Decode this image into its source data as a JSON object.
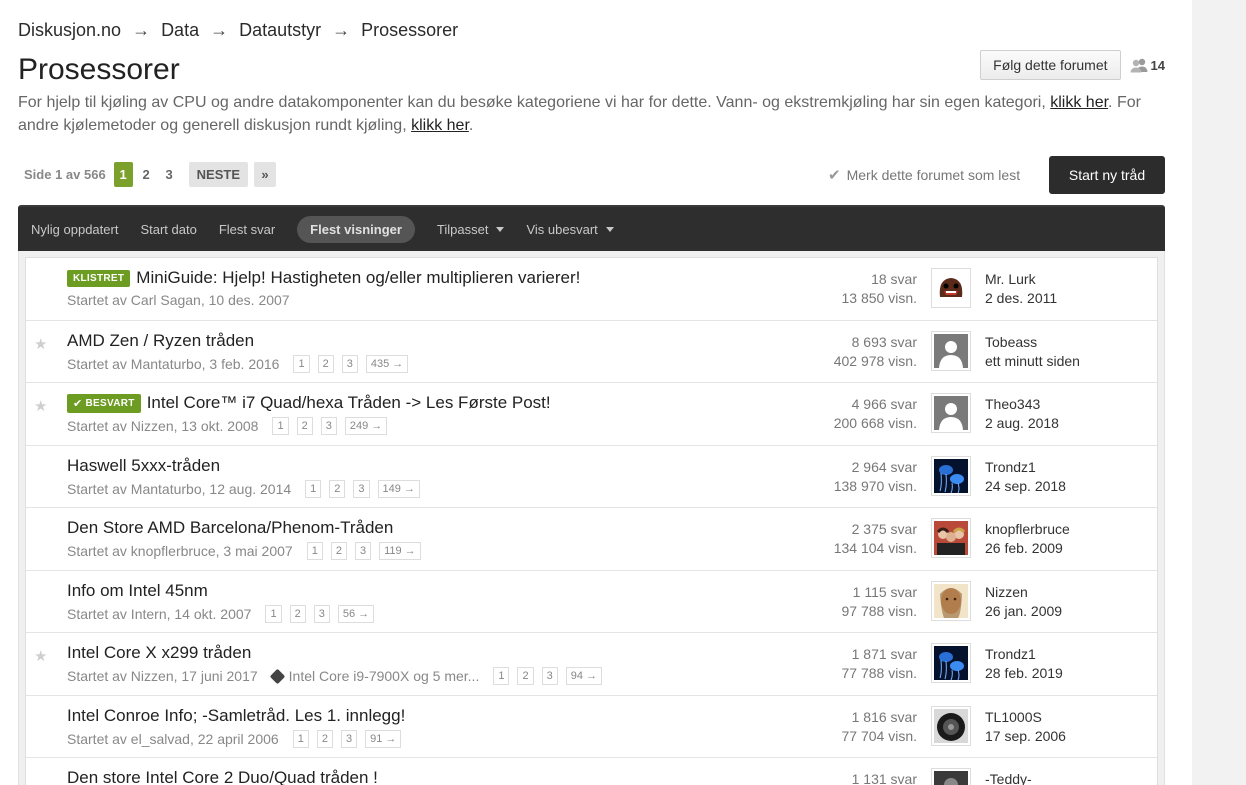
{
  "breadcrumb": [
    "Diskusjon.no",
    "Data",
    "Datautstyr",
    "Prosessorer"
  ],
  "breadcrumb_separator": "→",
  "page_title": "Prosessorer",
  "follow_button": "Følg dette forumet",
  "follower_count": "14",
  "description": {
    "part1": "For hjelp til kjøling av CPU og andre datakomponenter kan du besøke kategoriene vi har for dette. Vann- og ekstremkjøling har sin egen kategori, ",
    "link1": "klikk her",
    "part2": ". For andre kjølemetoder og generell diskusjon rundt kjøling, ",
    "link2": "klikk her",
    "part3": "."
  },
  "pagination": {
    "info": "Side 1 av 566",
    "pages": [
      "1",
      "2",
      "3"
    ],
    "current": "1",
    "next": "NESTE",
    "last": "»"
  },
  "mark_read": "Merk dette forumet som lest",
  "start_thread": "Start ny tråd",
  "sort_tabs": [
    {
      "label": "Nylig oppdatert",
      "active": false,
      "dropdown": false
    },
    {
      "label": "Start dato",
      "active": false,
      "dropdown": false
    },
    {
      "label": "Flest svar",
      "active": false,
      "dropdown": false
    },
    {
      "label": "Flest visninger",
      "active": true,
      "dropdown": false
    },
    {
      "label": "Tilpasset",
      "active": false,
      "dropdown": true
    },
    {
      "label": "Vis ubesvart",
      "active": false,
      "dropdown": true
    }
  ],
  "colors": {
    "accent_green": "#6d9c23",
    "sort_bar": "#2e2e2e",
    "start_button": "#2c2c2c"
  },
  "threads": [
    {
      "star": false,
      "tag": "KLISTRET",
      "title": "MiniGuide: Hjelp! Hastigheten og/eller multiplieren varierer!",
      "meta": "Startet av Carl Sagan, 10 des. 2007",
      "tags_text": "",
      "pages": [],
      "replies": "18 svar",
      "views": "13 850 visn.",
      "last_user": "Mr. Lurk",
      "last_date": "2 des. 2011",
      "avatar": "domo-icon"
    },
    {
      "star": true,
      "tag": "",
      "title": "AMD Zen / Ryzen tråden",
      "meta": "Startet av Mantaturbo, 3 feb. 2016",
      "tags_text": "",
      "pages": [
        "1",
        "2",
        "3",
        "435 →"
      ],
      "replies": "8 693 svar",
      "views": "402 978 visn.",
      "last_user": "Tobeass",
      "last_date": "ett minutt siden",
      "avatar": "default-user-icon"
    },
    {
      "star": true,
      "tag": "BESVART",
      "title": "Intel Core™ i7 Quad/hexa Tråden -> Les Første Post!",
      "meta": "Startet av Nizzen, 13 okt. 2008",
      "tags_text": "",
      "pages": [
        "1",
        "2",
        "3",
        "249 →"
      ],
      "replies": "4 966 svar",
      "views": "200 668 visn.",
      "last_user": "Theo343",
      "last_date": "2 aug. 2018",
      "avatar": "default-user-icon"
    },
    {
      "star": false,
      "tag": "",
      "title": "Haswell 5xxx-tråden",
      "meta": "Startet av Mantaturbo, 12 aug. 2014",
      "tags_text": "",
      "pages": [
        "1",
        "2",
        "3",
        "149 →"
      ],
      "replies": "2 964 svar",
      "views": "138 970 visn.",
      "last_user": "Trondz1",
      "last_date": "24 sep. 2018",
      "avatar": "jellyfish-photo"
    },
    {
      "star": false,
      "tag": "",
      "title": "Den Store AMD Barcelona/Phenom-Tråden",
      "meta": "Startet av knopflerbruce, 3 mai 2007",
      "tags_text": "",
      "pages": [
        "1",
        "2",
        "3",
        "119 →"
      ],
      "replies": "2 375 svar",
      "views": "134 104 visn.",
      "last_user": "knopflerbruce",
      "last_date": "26 feb. 2009",
      "avatar": "group-photo"
    },
    {
      "star": false,
      "tag": "",
      "title": "Info om Intel 45nm",
      "meta": "Startet av Intern, 14 okt. 2007",
      "tags_text": "",
      "pages": [
        "1",
        "2",
        "3",
        "56 →"
      ],
      "replies": "1 115 svar",
      "views": "97 788 visn.",
      "last_user": "Nizzen",
      "last_date": "26 jan. 2009",
      "avatar": "portrait-photo"
    },
    {
      "star": true,
      "tag": "",
      "title": "Intel Core X x299 tråden",
      "meta": "Startet av Nizzen, 17 juni 2017",
      "tags_text": "Intel Core i9-7900X og 5 mer...",
      "pages": [
        "1",
        "2",
        "3",
        "94 →"
      ],
      "replies": "1 871 svar",
      "views": "77 788 visn.",
      "last_user": "Trondz1",
      "last_date": "28 feb. 2019",
      "avatar": "jellyfish-photo"
    },
    {
      "star": false,
      "tag": "",
      "title": "Intel Conroe Info; -Samletråd. Les 1. innlegg!",
      "meta": "Startet av el_salvad, 22 april 2006",
      "tags_text": "",
      "pages": [
        "1",
        "2",
        "3",
        "91 →"
      ],
      "replies": "1 816 svar",
      "views": "77 704 visn.",
      "last_user": "TL1000S",
      "last_date": "17 sep. 2006",
      "avatar": "wheel-photo"
    },
    {
      "star": false,
      "tag": "",
      "title": "Den store Intel Core 2 Duo/Quad tråden !",
      "meta": "",
      "tags_text": "",
      "pages": [],
      "replies": "1 131 svar",
      "views": "",
      "last_user": "-Teddy-",
      "last_date": "",
      "avatar": "dark-photo"
    }
  ]
}
